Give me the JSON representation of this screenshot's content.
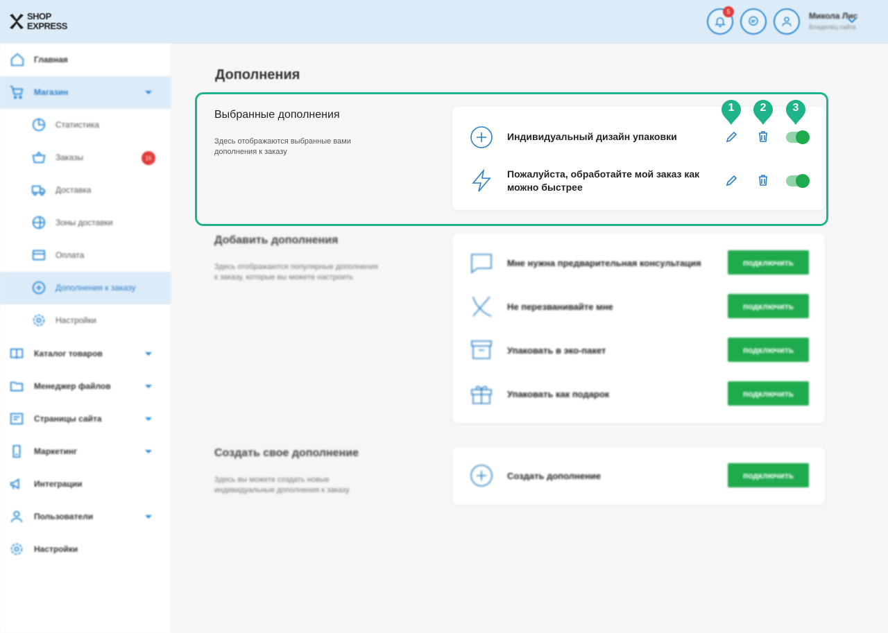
{
  "header": {
    "logo": {
      "line1": "SHOP",
      "line2": "EXPRESS"
    },
    "notifications_count": "5",
    "user": {
      "name": "Микола Лис",
      "role": "Владелец сайта"
    }
  },
  "sidebar": {
    "items": [
      {
        "label": "Главная",
        "icon": "home-icon"
      },
      {
        "label": "Магазин",
        "icon": "cart-icon"
      },
      {
        "label": "Статистика",
        "icon": "pie-chart-icon"
      },
      {
        "label": "Заказы",
        "icon": "basket-icon",
        "count": "15"
      },
      {
        "label": "Доставка",
        "icon": "truck-icon"
      },
      {
        "label": "Зоны доставки",
        "icon": "globe-icon"
      },
      {
        "label": "Оплата",
        "icon": "card-icon"
      },
      {
        "label": "Дополнения к заказу",
        "icon": "plus-circle-icon"
      },
      {
        "label": "Настройки",
        "icon": "gear-icon"
      },
      {
        "label": "Каталог товаров",
        "icon": "book-icon"
      },
      {
        "label": "Менеджер файлов",
        "icon": "folder-icon"
      },
      {
        "label": "Страницы сайта",
        "icon": "pages-icon"
      },
      {
        "label": "Маркетинг",
        "icon": "marketing-icon"
      },
      {
        "label": "Интеграции",
        "icon": "megaphone-icon"
      },
      {
        "label": "Пользователи",
        "icon": "users-icon"
      },
      {
        "label": "Настройки",
        "icon": "gear-icon"
      }
    ]
  },
  "main": {
    "title": "Дополнения",
    "selected": {
      "title": "Выбранные дополнения",
      "description": "Здесь отображаются выбранные вами дополнения к заказу",
      "rows": [
        {
          "label": "Индивидуальный дизайн упаковки",
          "icon": "plus-circle-icon",
          "enabled": true
        },
        {
          "label": "Пожалуйста, обработайте мой заказ как можно быстрее",
          "icon": "lightning-icon",
          "enabled": true
        }
      ],
      "markers": [
        "1",
        "2",
        "3"
      ]
    },
    "add": {
      "title": "Добавить дополнения",
      "description": "Здесь отображаются популярные дополнения к заказу, которые вы можете настроить",
      "rows": [
        {
          "label": "Мне нужна предварительная консультация",
          "icon": "chat-icon"
        },
        {
          "label": "Не перезванивайте мне",
          "icon": "no-call-icon"
        },
        {
          "label": "Упаковать в эко-пакет",
          "icon": "box-icon"
        },
        {
          "label": "Упаковать как подарок",
          "icon": "gift-icon"
        }
      ]
    },
    "create": {
      "title": "Создать свое дополнение",
      "description": "Здесь вы можете создать новые индивидуальные дополнения к заказу",
      "rows": [
        {
          "label": "Создать дополнение",
          "icon": "plus-circle-icon"
        }
      ]
    },
    "connect_label": "подключить"
  },
  "colors": {
    "accent": "#2c8bd6",
    "green": "#1faa4d",
    "highlight": "#1fb38a",
    "badge": "#e23b3b"
  }
}
